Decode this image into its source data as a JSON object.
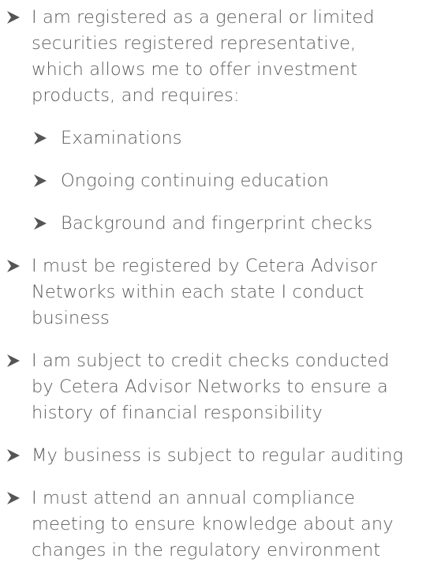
{
  "items": [
    {
      "lines": [
        "I am registered as a general or limited",
        "securities registered representative,",
        "which allows me to offer investment",
        "products, and requires:"
      ],
      "subitems": [
        "Examinations",
        "Ongoing continuing education",
        "Background and fingerprint checks"
      ]
    },
    {
      "lines": [
        "I must be registered by Cetera Advisor",
        "Networks within each state I conduct",
        "business"
      ]
    },
    {
      "lines": [
        "I am subject to credit checks conducted",
        "by Cetera Advisor Networks to ensure a",
        "history of financial responsibility"
      ]
    },
    {
      "lines": [
        "My business is subject to regular auditing"
      ]
    },
    {
      "lines": [
        "I must attend an annual compliance",
        "meeting to ensure knowledge about any",
        "changes in the regulatory environment"
      ]
    }
  ],
  "colors": {
    "text": "#5b5b5b",
    "bullet": "#555555"
  },
  "icons": {
    "bullet": "arrowhead-bullet-icon"
  }
}
